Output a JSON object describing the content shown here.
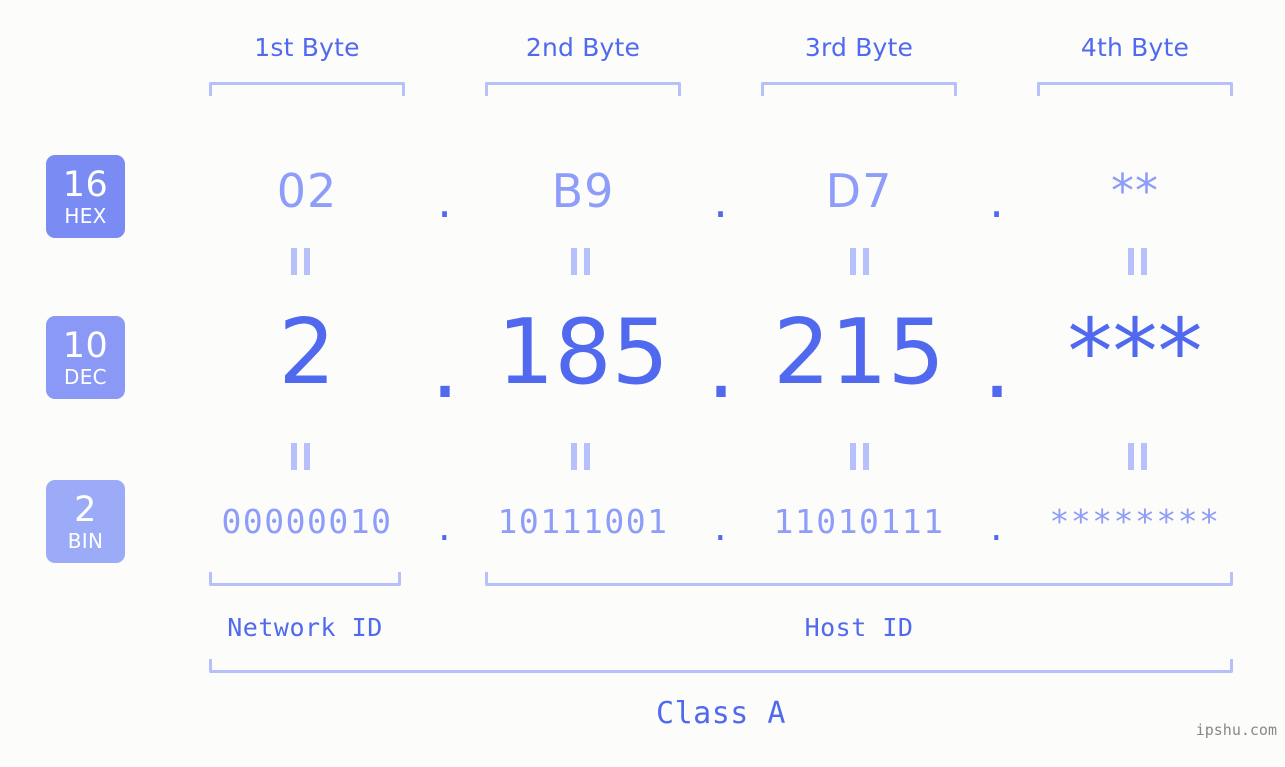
{
  "page": {
    "background_color": "#fcfdfa",
    "accent_strong": "#5069ee",
    "accent_mid": "#8e9df9",
    "accent_light": "#b6c0fb",
    "watermark": "ipshu.com"
  },
  "byte_headers": [
    {
      "label": "1st Byte"
    },
    {
      "label": "2nd Byte"
    },
    {
      "label": "3rd Byte"
    },
    {
      "label": "4th Byte"
    }
  ],
  "bases": [
    {
      "number": "16",
      "name": "HEX",
      "color": "#7a8cf4"
    },
    {
      "number": "10",
      "name": "DEC",
      "color": "#8b99f6"
    },
    {
      "number": "2",
      "name": "BIN",
      "color": "#9cabf8"
    }
  ],
  "rows": {
    "hex": {
      "base_number": "16",
      "base_name": "HEX",
      "values": [
        "02",
        "B9",
        "D7",
        "**"
      ],
      "separator": "."
    },
    "dec": {
      "base_number": "10",
      "base_name": "DEC",
      "values": [
        "2",
        "185",
        "215",
        "***"
      ],
      "separator": "."
    },
    "bin": {
      "base_number": "2",
      "base_name": "BIN",
      "values": [
        "00000010",
        "10111001",
        "11010111",
        "********"
      ],
      "separator": "."
    }
  },
  "segments": {
    "network_id": "Network ID",
    "host_id": "Host ID",
    "class": "Class A"
  }
}
